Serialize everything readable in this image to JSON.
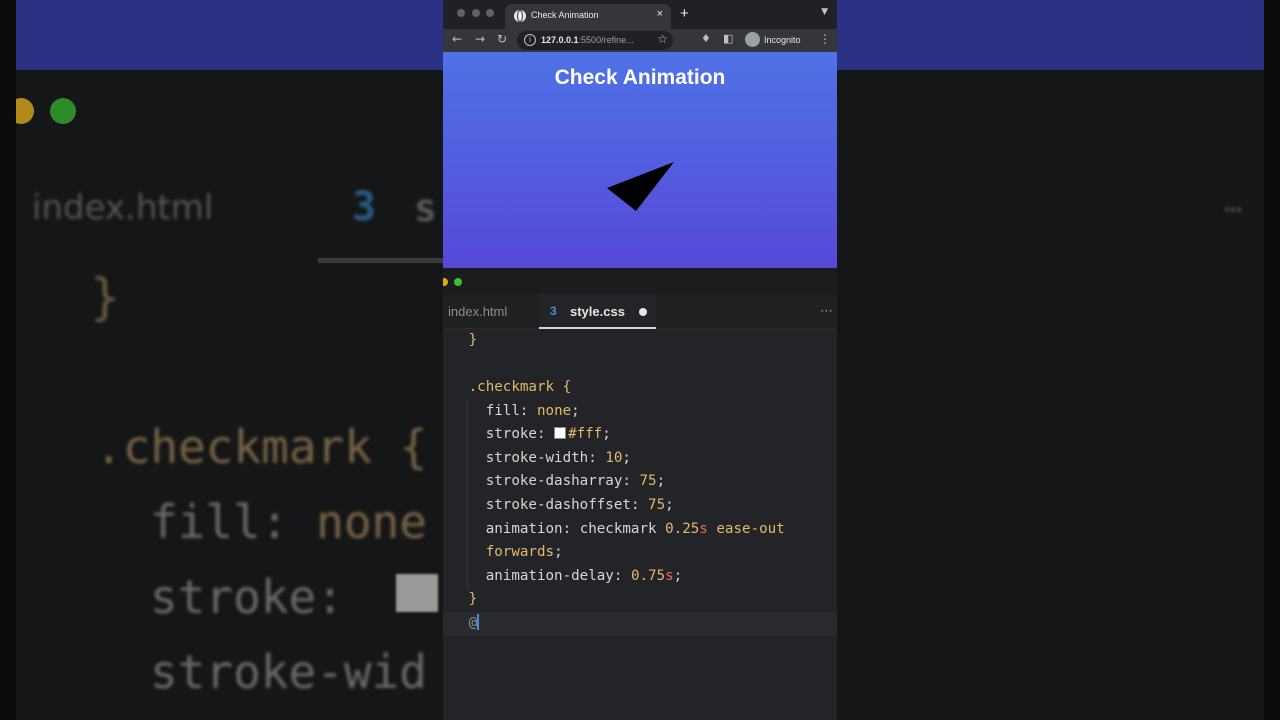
{
  "background": {
    "file_tab": "index.html",
    "css_tab_prefix": "s",
    "brace": "}",
    "selector": ".checkmark {",
    "fill_prop": "fill: ",
    "fill_val": "none",
    "stroke_prop": "stroke: ",
    "stroke_width_prop": "stroke-wid",
    "more": "⋯"
  },
  "browser": {
    "tab_title": "Check Animation",
    "tab_close": "×",
    "new_tab": "+",
    "url_host": "127.0.0.1",
    "url_rest": ":5500/refine...",
    "incognito_label": "Incognito"
  },
  "page": {
    "title": "Check Animation"
  },
  "editor": {
    "tabs": [
      {
        "label": "index.html"
      },
      {
        "label": "style.css"
      }
    ],
    "more": "⋯",
    "code": {
      "close_brace": "}",
      "selector": ".checkmark",
      "open_brace": "{",
      "fill_prop": "fill",
      "fill_val": "none",
      "stroke_prop": "stroke",
      "stroke_val": "#fff",
      "stroke_width_prop": "stroke-width",
      "stroke_width_val": "10",
      "dasharray_prop": "stroke-dasharray",
      "dasharray_val": "75",
      "dashoffset_prop": "stroke-dashoffset",
      "dashoffset_val": "75",
      "animation_prop": "animation",
      "animation_name": "checkmark",
      "animation_dur_num": "0.25",
      "animation_dur_unit": "s",
      "animation_ease": "ease-out",
      "animation_fill": "forwards",
      "delay_prop": "animation-delay",
      "delay_num": "0.75",
      "delay_unit": "s",
      "at": "@"
    }
  },
  "colors": {
    "accent": "#4c8cd8",
    "keyword": "#e2b86b",
    "unit": "#f0606c",
    "gradient_top": "#4f72e6",
    "gradient_bottom": "#5649d8"
  }
}
